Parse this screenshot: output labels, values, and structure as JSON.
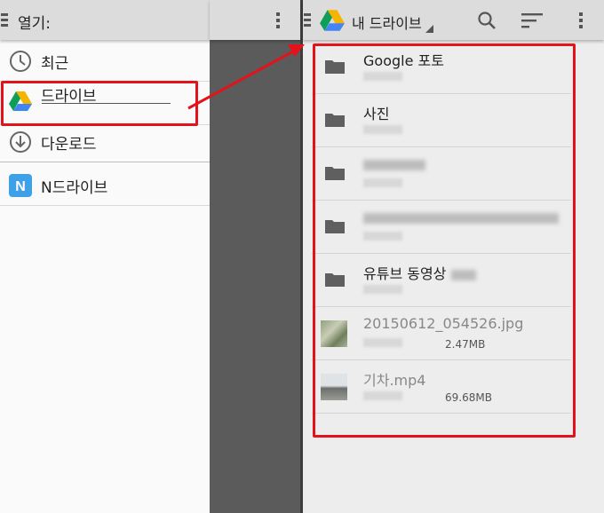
{
  "left_panel": {
    "title": "열기:",
    "items": [
      {
        "label": "최근",
        "icon": "clock-icon"
      },
      {
        "label": "드라이브",
        "icon": "google-drive-icon"
      },
      {
        "label": "다운로드",
        "icon": "download-icon"
      },
      {
        "label": "N드라이브",
        "icon": "ndrive-icon"
      }
    ]
  },
  "right_panel": {
    "title": "내 드라이브",
    "toolbar": {
      "search": "search-icon",
      "sort": "sort-icon",
      "menu": "overflow-menu-icon"
    },
    "items": [
      {
        "type": "folder",
        "name": "Google 포토"
      },
      {
        "type": "folder",
        "name": "사진"
      },
      {
        "type": "folder",
        "name": ""
      },
      {
        "type": "folder",
        "name": ""
      },
      {
        "type": "folder",
        "name": "유튜브 동영상"
      },
      {
        "type": "file",
        "name": "20150612_054526.jpg",
        "size": "2.47MB"
      },
      {
        "type": "file",
        "name": "기차.mp4",
        "size": "69.68MB"
      }
    ]
  },
  "colors": {
    "highlight": "#e3131b",
    "drive_green": "#0f9d58",
    "drive_yellow": "#f4b400",
    "drive_blue": "#4285f4",
    "ndrive_blue": "#3ea0e6"
  }
}
